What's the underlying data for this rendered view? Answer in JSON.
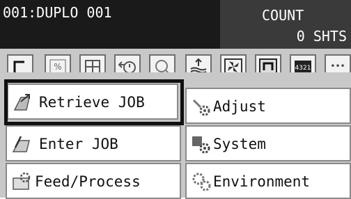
{
  "header": {
    "job_name": "001:DUPLO 001",
    "count_label": "COUNT",
    "count_value": "0 SHTS"
  },
  "toolbar": {
    "icons": [
      "corner-icon",
      "percent-icon",
      "layout-icon",
      "arrow-clock-icon",
      "magnifier-icon",
      "stack-icon",
      "fan-icon",
      "return-icon",
      "counter-icon",
      "more-icon"
    ],
    "counter_text": "4321",
    "more_text": "•••"
  },
  "menu": {
    "retrieve_job": "Retrieve JOB",
    "adjust": "Adjust",
    "enter_job": "Enter JOB",
    "system": "System",
    "feed_process": "Feed/Process",
    "environment": "Environment"
  },
  "colors": {
    "header_dark": "#1a1a1a",
    "count_panel": "#3a3a3a",
    "toolbar_bg": "#c8c8c8"
  }
}
